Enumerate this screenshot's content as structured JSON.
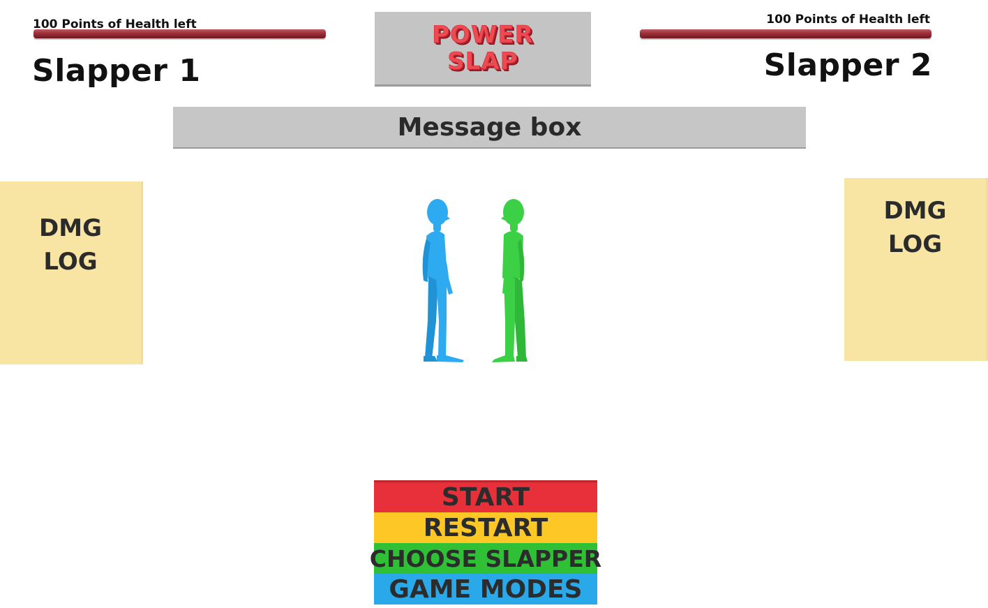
{
  "players": [
    {
      "health_text": "100 Points of Health left",
      "health": 100,
      "name": "Slapper 1",
      "color": "#2eaaf0"
    },
    {
      "health_text": "100 Points of Health left",
      "health": 100,
      "name": "Slapper 2",
      "color": "#3cd046"
    }
  ],
  "logo": {
    "line1": "POWER",
    "line2": "SLAP"
  },
  "message_box": "Message box",
  "dmg_logs": [
    {
      "line1": "DMG",
      "line2": "LOG"
    },
    {
      "line1": "DMG",
      "line2": "LOG"
    }
  ],
  "menu": {
    "start": "START",
    "restart": "RESTART",
    "choose": "CHOOSE SLAPPER",
    "modes": "GAME MODES"
  },
  "colors": {
    "health_bar": "#9c2f39",
    "start": "#e8303a",
    "restart": "#fdc826",
    "choose": "#2fc035",
    "modes": "#2aa9ea"
  }
}
